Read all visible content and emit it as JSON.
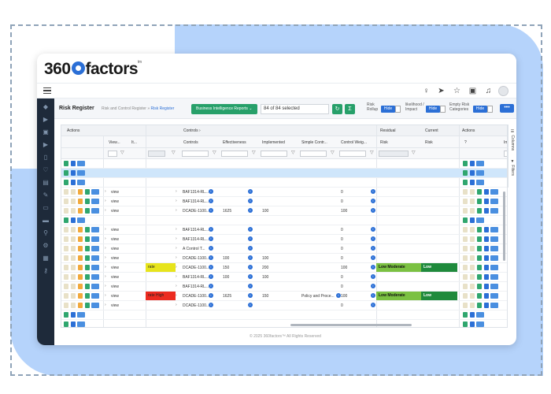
{
  "app": {
    "logo_text": "360factors",
    "logo_tm": "tm"
  },
  "header": {
    "page_title": "Risk Register",
    "breadcrumb": {
      "parent": "Risk and Control Register",
      "current": "Risk Register"
    },
    "bi_reports_label": "Business Intelligence Reports",
    "selected_label": "84 of 84 selected",
    "toggles": [
      {
        "label": "Risk Rollup",
        "button": "Hide"
      },
      {
        "label": "likelihood / Impact",
        "button": "Hide"
      },
      {
        "label": "Empty Risk Categories",
        "button": "Hide"
      }
    ],
    "more_label": "•••"
  },
  "grid": {
    "group_headers": {
      "actions": "Actions",
      "controls": "Controls",
      "residual": "Residual",
      "current": "Current",
      "actions_right": "Actions"
    },
    "columns": [
      "View...",
      "It...",
      "Controls",
      "Effectiveness",
      "Implemented",
      "Simple Contr...",
      "Control Weig...",
      "Risk",
      "Risk",
      "?",
      "Im"
    ],
    "side_tabs": {
      "columns": "Columns",
      "filters": "Filters"
    },
    "rows": [
      {
        "control": "",
        "eff": "",
        "impl": "",
        "simple": "",
        "weight": "",
        "residual": "",
        "current": "",
        "view": ""
      },
      {
        "control": "",
        "eff": "",
        "impl": "",
        "simple": "",
        "weight": "",
        "residual": "",
        "current": "",
        "view": ""
      },
      {
        "control": "",
        "eff": "",
        "impl": "",
        "simple": "",
        "weight": "",
        "residual": "",
        "current": "",
        "view": ""
      },
      {
        "control": "BAF1314-RL...",
        "eff": "",
        "impl": "",
        "simple": "",
        "weight": "0",
        "residual": "",
        "current": "",
        "view": "view"
      },
      {
        "control": "BAF1314-RL...",
        "eff": "",
        "impl": "",
        "simple": "",
        "weight": "0",
        "residual": "",
        "current": "",
        "view": "view"
      },
      {
        "control": "DCADE-1100...",
        "eff": "1625",
        "impl": "100",
        "simple": "",
        "weight": "100",
        "residual": "",
        "current": "",
        "view": "view"
      },
      {
        "control": "",
        "eff": "",
        "impl": "",
        "simple": "",
        "weight": "",
        "residual": "",
        "current": "",
        "view": ""
      },
      {
        "control": "BAF1314-RL...",
        "eff": "",
        "impl": "",
        "simple": "",
        "weight": "0",
        "residual": "",
        "current": "",
        "view": "view"
      },
      {
        "control": "BAF1314-RL...",
        "eff": "",
        "impl": "",
        "simple": "",
        "weight": "0",
        "residual": "",
        "current": "",
        "view": "view"
      },
      {
        "control": "A Control T...",
        "eff": "",
        "impl": "",
        "simple": "",
        "weight": "0",
        "residual": "",
        "current": "",
        "view": "view"
      },
      {
        "control": "DCADE-1100...",
        "eff": "100",
        "impl": "100",
        "simple": "",
        "weight": "0",
        "residual": "",
        "current": "",
        "view": "view"
      },
      {
        "control": "DCADE-1100...",
        "eff": "150",
        "impl": "200",
        "simple": "",
        "weight": "100",
        "residual": "Low Moderate",
        "current": "Low",
        "view": "view",
        "band": "rate"
      },
      {
        "control": "BAF1314-RL...",
        "eff": "100",
        "impl": "100",
        "simple": "",
        "weight": "0",
        "residual": "",
        "current": "",
        "view": "view"
      },
      {
        "control": "BAF1314-RL...",
        "eff": "",
        "impl": "",
        "simple": "",
        "weight": "0",
        "residual": "",
        "current": "",
        "view": "view"
      },
      {
        "control": "DCADE-1100...",
        "eff": "1625",
        "impl": "150",
        "simple": "Policy and Proce...",
        "weight": "100",
        "residual": "Low Moderate",
        "current": "Low",
        "view": "view",
        "band": "rate High"
      },
      {
        "control": "DCADE-1100...",
        "eff": "",
        "impl": "",
        "simple": "",
        "weight": "0",
        "residual": "",
        "current": "",
        "view": "view"
      },
      {
        "control": "",
        "eff": "",
        "impl": "",
        "simple": "",
        "weight": "",
        "residual": "",
        "current": "",
        "view": ""
      },
      {
        "control": "",
        "eff": "",
        "impl": "",
        "simple": "",
        "weight": "",
        "residual": "",
        "current": "",
        "view": ""
      }
    ]
  },
  "footer": {
    "text": "© 2025 360factors™ All Rights Reserved"
  },
  "colors": {
    "accent": "#2b6fd6",
    "green": "#27a06a",
    "low_moderate": "#7bc142",
    "low": "#1f8a3c",
    "band_yellow": "#e7e41c",
    "band_red": "#ec2b20",
    "sidebar": "#1e2a3a"
  }
}
